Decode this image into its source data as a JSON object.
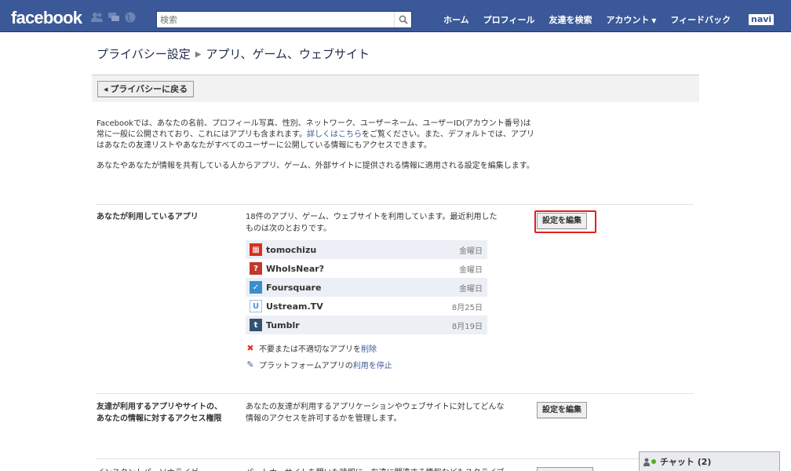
{
  "header": {
    "logo": "facebook",
    "search_placeholder": "検索",
    "nav": [
      "ホーム",
      "プロフィール",
      "友達を検索",
      "アカウント",
      "フィードバック"
    ],
    "user_badge": "navi"
  },
  "breadcrumb": {
    "root": "プライバシー設定",
    "current": "アプリ、ゲーム、ウェブサイト"
  },
  "back_button": "プライバシーに戻る",
  "intro": {
    "p1_before_link": "Facebookでは、あなたの名前、プロフィール写真、性別、ネットワーク、ユーザーネーム、ユーザーID(アカウント番号)は常に一般に公開されており、これにはアプリも含まれます。",
    "p1_link": "詳しくはこちら",
    "p1_after_link": "をご覧ください。また、デフォルトでは、アプリはあなたの友達リストやあなたがすべてのユーザーに公開している情報にもアクセスできます。",
    "p2": "あなたやあなたが情報を共有している人からアプリ、ゲーム、外部サイトに提供される情報に適用される設定を編集します。"
  },
  "section_apps": {
    "title": "あなたが利用しているアプリ",
    "description": "18件のアプリ、ゲーム、ウェブサイトを利用しています。最近利用したものは次のとおりです。",
    "edit_button": "設定を編集",
    "apps": [
      {
        "name": "tomochizu",
        "date": "金曜日",
        "icon": "tomochizu-icon",
        "color": "#d6311e"
      },
      {
        "name": "WhoIsNear?",
        "date": "金曜日",
        "icon": "whoisnear-icon",
        "color": "#c0392b"
      },
      {
        "name": "Foursquare",
        "date": "金曜日",
        "icon": "foursquare-icon",
        "color": "#3a8fd1"
      },
      {
        "name": "Ustream.TV",
        "date": "8月25日",
        "icon": "ustream-icon",
        "color": "#4a90d9"
      },
      {
        "name": "Tumblr",
        "date": "8月19日",
        "icon": "tumblr-icon",
        "color": "#34526f"
      }
    ],
    "remove_text": "不要または不適切なアプリを",
    "remove_link": "削除",
    "platform_text": "プラットフォームアプリの",
    "platform_link": "利用を停止"
  },
  "section_friends": {
    "title": "友達が利用するアプリやサイトの、あなたの情報に対するアクセス権限",
    "description": "あなたの友達が利用するアプリケーションやウェブサイトに対してどんな情報のアクセスを許可するかを管理します。",
    "edit_button": "設定を編集"
  },
  "section_cut": {
    "title": "インスタントパーソナライゼ",
    "description": "パートナーサイトを開いた時即に、友達に関連する情報などもスクライブ"
  },
  "chat": {
    "label": "チャット (2)"
  },
  "colors": {
    "brand": "#3b5998",
    "highlight": "#e02020"
  }
}
